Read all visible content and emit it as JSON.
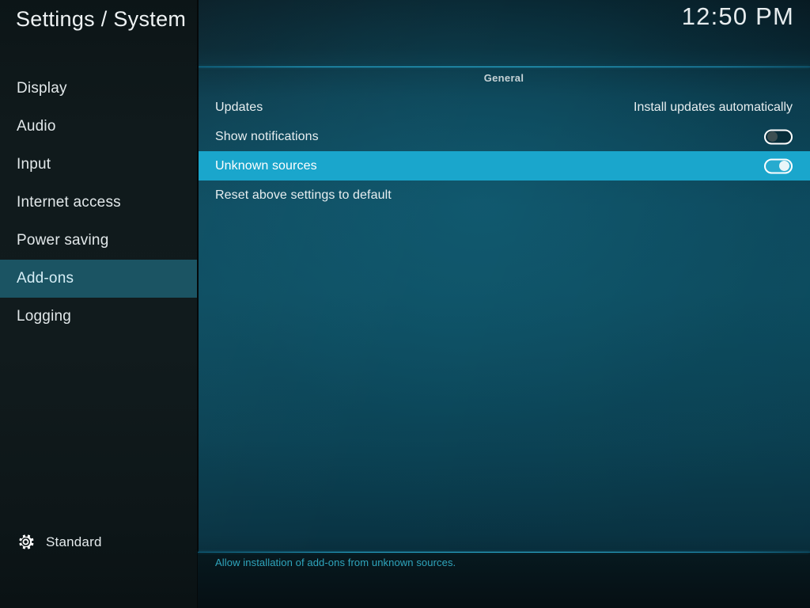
{
  "header": {
    "title": "Settings / System",
    "clock": "12:50 PM"
  },
  "sidebar": {
    "items": [
      {
        "label": "Display",
        "selected": false
      },
      {
        "label": "Audio",
        "selected": false
      },
      {
        "label": "Input",
        "selected": false
      },
      {
        "label": "Internet access",
        "selected": false
      },
      {
        "label": "Power saving",
        "selected": false
      },
      {
        "label": "Add-ons",
        "selected": true
      },
      {
        "label": "Logging",
        "selected": false
      }
    ],
    "profile": {
      "icon": "gear-icon",
      "label": "Standard"
    }
  },
  "main": {
    "group_title": "General",
    "rows": [
      {
        "label": "Updates",
        "control": "value",
        "value": "Install updates automatically",
        "selected": false
      },
      {
        "label": "Show notifications",
        "control": "toggle",
        "toggle_state": "off",
        "selected": false
      },
      {
        "label": "Unknown sources",
        "control": "toggle",
        "toggle_state": "on",
        "selected": true
      },
      {
        "label": "Reset above settings to default",
        "control": "none",
        "selected": false
      }
    ]
  },
  "footer": {
    "description": "Allow installation of add-ons from unknown sources."
  },
  "colors": {
    "sidebar_bg": "#101a1c",
    "sidebar_selected": "#1b5463",
    "row_selected": "#1aa6cc",
    "accent_rule": "#2ab0d6",
    "main_bg_top": "#0d4e63",
    "main_bg_bottom": "#07222c",
    "description_text": "#2fa5bd",
    "primary_text": "#e7eef0"
  }
}
